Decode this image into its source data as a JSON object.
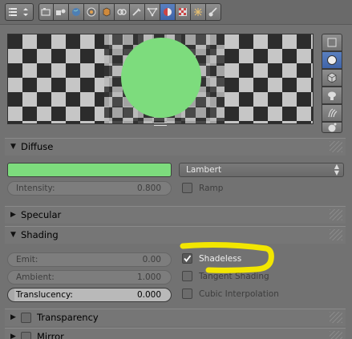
{
  "header": {
    "context_icons": [
      "render-icon",
      "scene-icon",
      "world-icon",
      "object-icon",
      "constraints-icon",
      "modifiers-icon",
      "data-icon",
      "material-icon",
      "texture-icon",
      "particles-icon",
      "physics-icon"
    ],
    "active_tab": "material-icon"
  },
  "preview_side_icons": [
    "flat-preview-icon",
    "sphere-preview-icon",
    "cube-preview-icon",
    "monkey-preview-icon",
    "hair-preview-icon",
    "sphere-sky-preview-icon"
  ],
  "colors": {
    "diffuse": "#7ddc7d",
    "annotation": "#f2e600"
  },
  "diffuse": {
    "title": "Diffuse",
    "shader": "Lambert",
    "intensity_label": "Intensity:",
    "intensity_value": "0.800",
    "ramp_label": "Ramp"
  },
  "specular": {
    "title": "Specular"
  },
  "shading": {
    "title": "Shading",
    "emit_label": "Emit:",
    "emit_value": "0.00",
    "ambient_label": "Ambient:",
    "ambient_value": "1.000",
    "translucency_label": "Translucency:",
    "translucency_value": "0.000",
    "shadeless_label": "Shadeless",
    "shadeless_checked": true,
    "tangent_label": "Tangent Shading",
    "cubic_label": "Cubic Interpolation"
  },
  "transparency": {
    "title": "Transparency"
  },
  "mirror": {
    "title": "Mirror"
  }
}
